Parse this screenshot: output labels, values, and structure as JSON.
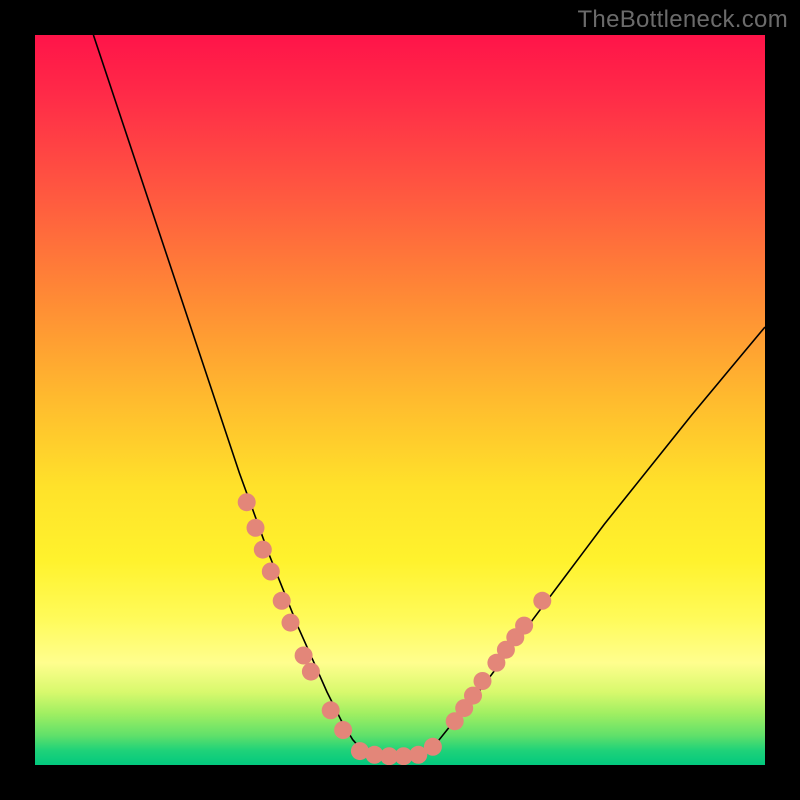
{
  "watermark": "TheBottleneck.com",
  "colors": {
    "dot": "#e38679",
    "curve": "#000000",
    "frame": "#000000"
  },
  "chart_data": {
    "type": "line",
    "title": "",
    "xlabel": "",
    "ylabel": "",
    "xlim": [
      0,
      100
    ],
    "ylim": [
      0,
      100
    ],
    "grid": false,
    "legend": false,
    "series": [
      {
        "name": "curve-left",
        "x": [
          8,
          10,
          12,
          14,
          16,
          18,
          20,
          22,
          24,
          26,
          28,
          30,
          32,
          34,
          36,
          38,
          40,
          42,
          43.5,
          45
        ],
        "y": [
          100,
          94,
          88,
          82,
          76,
          70,
          64,
          58,
          52,
          46,
          40,
          34.5,
          29,
          24,
          19,
          14.5,
          10,
          6,
          3.5,
          1.8
        ]
      },
      {
        "name": "flat-bottom",
        "x": [
          45,
          47,
          49,
          51,
          53
        ],
        "y": [
          1.8,
          1.3,
          1.1,
          1.2,
          1.5
        ]
      },
      {
        "name": "curve-right",
        "x": [
          53,
          55,
          57,
          60,
          63,
          66,
          69,
          72,
          75,
          78,
          82,
          86,
          90,
          95,
          100
        ],
        "y": [
          1.5,
          3,
          5.5,
          9,
          13,
          17,
          21,
          25,
          29,
          33,
          38,
          43,
          48,
          54,
          60
        ]
      }
    ],
    "points": [
      {
        "name": "left-cluster",
        "x": 29.0,
        "y": 36.0
      },
      {
        "name": "left-cluster",
        "x": 30.2,
        "y": 32.5
      },
      {
        "name": "left-cluster",
        "x": 31.2,
        "y": 29.5
      },
      {
        "name": "left-cluster",
        "x": 32.3,
        "y": 26.5
      },
      {
        "name": "left-cluster",
        "x": 33.8,
        "y": 22.5
      },
      {
        "name": "left-cluster",
        "x": 35.0,
        "y": 19.5
      },
      {
        "name": "left-cluster",
        "x": 36.8,
        "y": 15.0
      },
      {
        "name": "left-cluster",
        "x": 37.8,
        "y": 12.8
      },
      {
        "name": "left-cluster",
        "x": 40.5,
        "y": 7.5
      },
      {
        "name": "left-cluster",
        "x": 42.2,
        "y": 4.8
      },
      {
        "name": "bottom",
        "x": 44.5,
        "y": 1.9
      },
      {
        "name": "bottom",
        "x": 46.5,
        "y": 1.4
      },
      {
        "name": "bottom",
        "x": 48.5,
        "y": 1.2
      },
      {
        "name": "bottom",
        "x": 50.5,
        "y": 1.2
      },
      {
        "name": "bottom",
        "x": 52.5,
        "y": 1.4
      },
      {
        "name": "right-cluster",
        "x": 54.5,
        "y": 2.5
      },
      {
        "name": "right-cluster",
        "x": 57.5,
        "y": 6.0
      },
      {
        "name": "right-cluster",
        "x": 58.8,
        "y": 7.8
      },
      {
        "name": "right-cluster",
        "x": 60.0,
        "y": 9.5
      },
      {
        "name": "right-cluster",
        "x": 61.3,
        "y": 11.5
      },
      {
        "name": "right-cluster",
        "x": 63.2,
        "y": 14.0
      },
      {
        "name": "right-cluster",
        "x": 64.5,
        "y": 15.8
      },
      {
        "name": "right-cluster",
        "x": 65.8,
        "y": 17.5
      },
      {
        "name": "right-cluster",
        "x": 67.0,
        "y": 19.1
      },
      {
        "name": "right-cluster",
        "x": 69.5,
        "y": 22.5
      }
    ]
  }
}
